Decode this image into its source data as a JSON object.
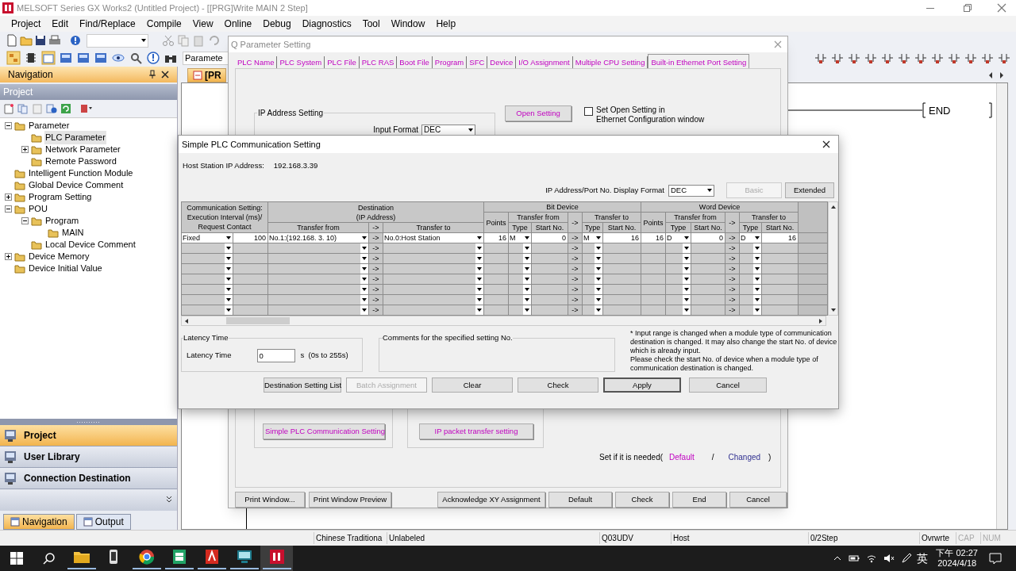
{
  "window": {
    "title": "MELSOFT Series GX Works2 (Untitled Project) - [[PRG]Write MAIN 2 Step]"
  },
  "menu": [
    "Project",
    "Edit",
    "Find/Replace",
    "Compile",
    "View",
    "Online",
    "Debug",
    "Diagnostics",
    "Tool",
    "Window",
    "Help"
  ],
  "toolbar": {
    "combo_value": "Paramete"
  },
  "navigation": {
    "title": "Navigation",
    "section": "Project",
    "tree": [
      {
        "label": "Parameter",
        "expanded": true,
        "selected": false,
        "children": [
          {
            "label": "PLC Parameter",
            "selected": true
          },
          {
            "label": "Network Parameter",
            "expanded": false,
            "selected": false
          },
          {
            "label": "Remote Password",
            "selected": false
          }
        ]
      },
      {
        "label": "Intelligent Function Module",
        "selected": false
      },
      {
        "label": "Global Device Comment",
        "selected": false
      },
      {
        "label": "Program Setting",
        "expanded": false,
        "selected": false
      },
      {
        "label": "POU",
        "expanded": true,
        "selected": false,
        "children": [
          {
            "label": "Program",
            "expanded": true,
            "selected": false,
            "children": [
              {
                "label": "MAIN",
                "selected": false
              }
            ]
          },
          {
            "label": "Local Device Comment",
            "selected": false
          }
        ]
      },
      {
        "label": "Device Memory",
        "expanded": false,
        "selected": false
      },
      {
        "label": "Device Initial Value",
        "selected": false
      }
    ],
    "panels": [
      {
        "label": "Project",
        "selected": true
      },
      {
        "label": "User Library",
        "selected": false
      },
      {
        "label": "Connection Destination",
        "selected": false
      }
    ],
    "tabs": [
      {
        "label": "Navigation",
        "selected": true
      },
      {
        "label": "Output",
        "selected": false
      }
    ]
  },
  "editor": {
    "tab": "[PR",
    "instruction": "END"
  },
  "q_parameter": {
    "title": "Q Parameter Setting",
    "tabs": [
      {
        "label": "PLC Name",
        "selected": false
      },
      {
        "label": "PLC System",
        "selected": false
      },
      {
        "label": "PLC File",
        "selected": false
      },
      {
        "label": "PLC RAS",
        "selected": false
      },
      {
        "label": "Boot File",
        "selected": false
      },
      {
        "label": "Program",
        "selected": false
      },
      {
        "label": "SFC",
        "selected": false
      },
      {
        "label": "Device",
        "selected": false
      },
      {
        "label": "I/O Assignment",
        "selected": false
      },
      {
        "label": "Multiple CPU Setting",
        "selected": false
      },
      {
        "label": "Built-in Ethernet Port Setting",
        "selected": true
      }
    ],
    "ip_group": "IP Address Setting",
    "input_format_label": "Input Format",
    "input_format": "DEC",
    "open_setting": "Open Setting",
    "open_setting_check": {
      "label": "Set Open Setting in\nEthernet Configuration window",
      "checked": false
    },
    "simple_plc_button": "Simple PLC Communication Setting",
    "ip_packet_button": "IP packet transfer setting",
    "needed": {
      "prefix": "Set if it is needed(",
      "default": "Default",
      "slash": "/",
      "changed": "Changed",
      "suffix": ")"
    },
    "buttons": [
      "Print Window...",
      "Print Window Preview",
      "Acknowledge XY Assignment",
      "Default",
      "Check",
      "End",
      "Cancel"
    ]
  },
  "simple_plc": {
    "title": "Simple PLC Communication Setting",
    "host_label": "Host Station IP Address:",
    "host_ip": "192.168.3.39",
    "format_label": "IP Address/Port No. Display Format",
    "format": "DEC",
    "buttons_top": [
      {
        "label": "Basic",
        "disabled": true
      },
      {
        "label": "Extended",
        "disabled": false
      }
    ],
    "header": {
      "setting": "Communication Setting:\nExecution Interval (ms)/\nRequest Contact",
      "destination": "Destination\n(IP Address)",
      "dest_from": "Transfer from",
      "dest_arrow": "->",
      "dest_to": "Transfer to",
      "bit": {
        "title": "Bit Device",
        "points": "Points",
        "from": "Transfer from",
        "arrow": "->",
        "to": "Transfer to",
        "from_type": "Type",
        "from_start": "Start No.",
        "to_type": "Type",
        "to_start": "Start No."
      },
      "word": {
        "title": "Word Device",
        "points": "Points",
        "from": "Transfer from",
        "arrow": "->",
        "to": "Transfer to",
        "from_type": "Type",
        "from_start": "Start No.",
        "to_type": "Type",
        "to_start": "Start No."
      }
    },
    "rows": [
      {
        "request": "Fixed",
        "interval": "100",
        "dest_from": "No.1:(192.168.  3. 10)",
        "arrow_1": "->",
        "dest_to": "No.0:Host Station",
        "bit_points": "16",
        "bit_from_type": "M",
        "bit_from_start": "0",
        "arrow_2": "->",
        "bit_to_type": "M",
        "bit_to_start": "16",
        "word_points": "16",
        "word_from_type": "D",
        "word_from_start": "0",
        "arrow_3": "->",
        "word_to_type": "D",
        "word_to_start": "16"
      },
      {
        "arrow_1": "->",
        "arrow_2": "->",
        "arrow_3": "->"
      },
      {
        "arrow_1": "->",
        "arrow_2": "->",
        "arrow_3": "->"
      },
      {
        "arrow_1": "->",
        "arrow_2": "->",
        "arrow_3": "->"
      },
      {
        "arrow_1": "->",
        "arrow_2": "->",
        "arrow_3": "->"
      },
      {
        "arrow_1": "->",
        "arrow_2": "->",
        "arrow_3": "->"
      },
      {
        "arrow_1": "->",
        "arrow_2": "->",
        "arrow_3": "->"
      },
      {
        "arrow_1": "->",
        "arrow_2": "->",
        "arrow_3": "->"
      }
    ],
    "latency": {
      "group": "Latency Time",
      "label": "Latency Time",
      "value": "0",
      "unit": "s  (0s to 255s)"
    },
    "comments_group": "Comments for the specified setting No.",
    "note": "* Input range is changed when a module type of communication destination is changed. It may also change the start No. of device which is already input.\nPlease check the start No. of device when a module type of communication destination is changed.",
    "buttons": [
      {
        "label": "Destination Setting List",
        "disabled": false,
        "default": false
      },
      {
        "label": "Batch Assignment",
        "disabled": true,
        "default": false
      },
      {
        "label": "Clear",
        "disabled": false,
        "default": false
      },
      {
        "label": "Check",
        "disabled": false,
        "default": false
      },
      {
        "label": "Apply",
        "disabled": false,
        "default": true
      },
      {
        "label": "Cancel",
        "disabled": false,
        "default": false
      }
    ]
  },
  "status_bar": [
    {
      "text": "Chinese Traditiona",
      "disabled": false
    },
    {
      "text": "Unlabeled",
      "disabled": false
    },
    {
      "text": "Q03UDV",
      "disabled": false
    },
    {
      "text": "Host",
      "disabled": false
    },
    {
      "text": "0/2Step",
      "disabled": false
    },
    {
      "text": "Ovrwrte",
      "disabled": false
    },
    {
      "text": "CAP",
      "disabled": true
    },
    {
      "text": "NUM",
      "disabled": true
    }
  ],
  "taskbar": {
    "apps": [
      {
        "running": true,
        "selected": false
      },
      {
        "running": false,
        "selected": false
      },
      {
        "running": true,
        "selected": false
      },
      {
        "running": true,
        "selected": false
      },
      {
        "running": true,
        "selected": false
      },
      {
        "running": true,
        "selected": false
      },
      {
        "running": true,
        "selected": true
      }
    ],
    "ime": "英",
    "time": "下午 02:27",
    "date": "2024/4/18"
  }
}
